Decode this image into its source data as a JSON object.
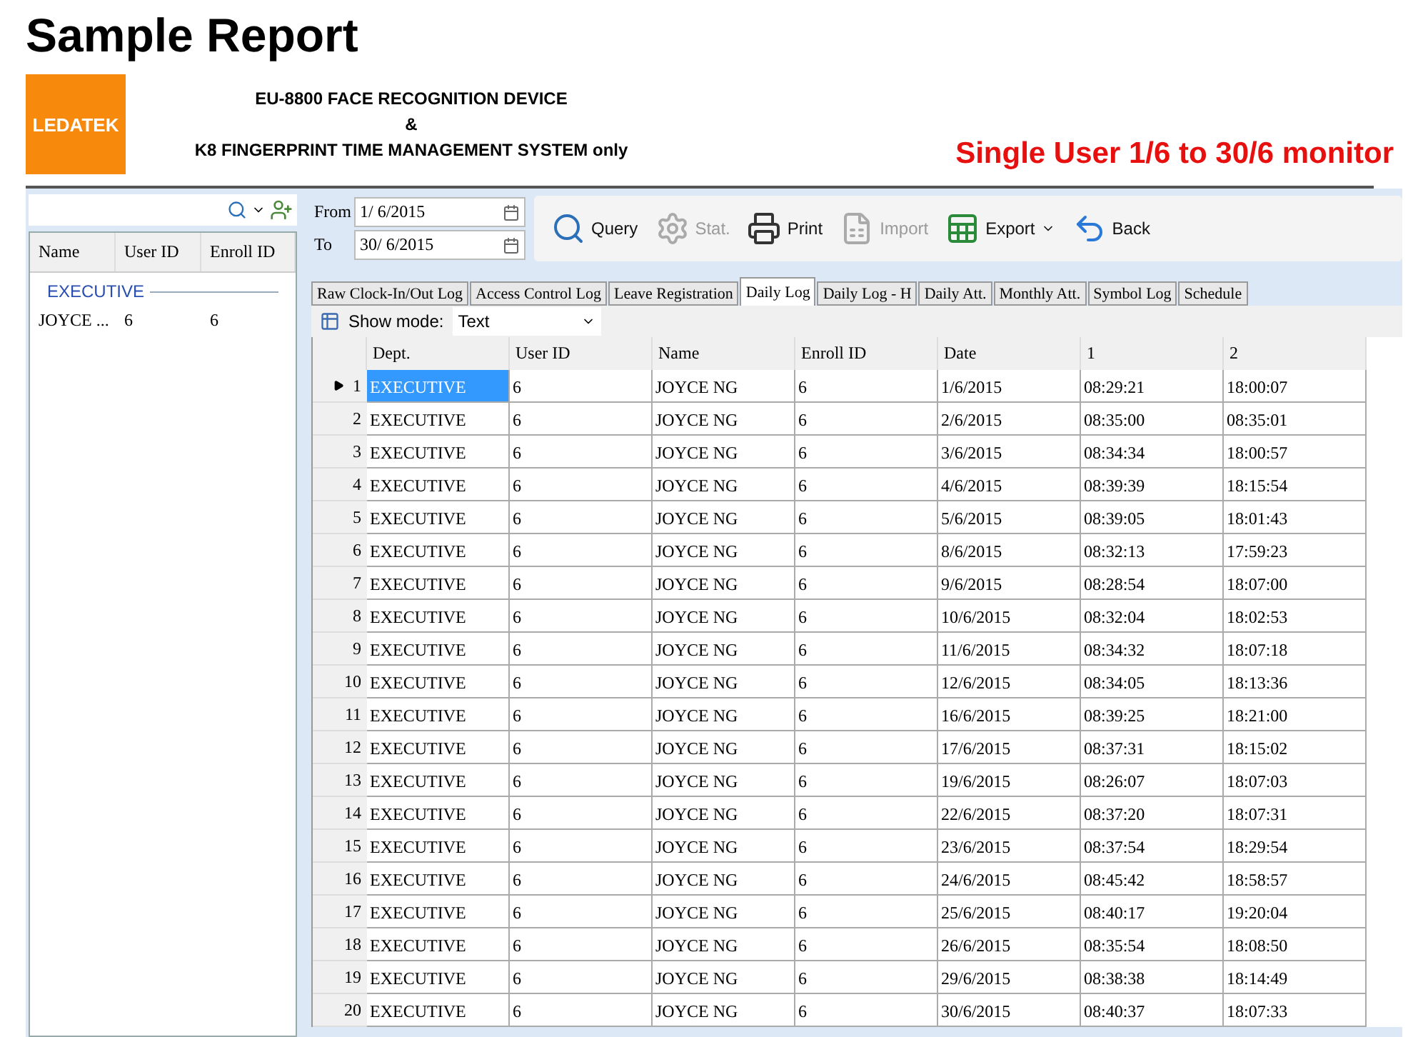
{
  "page_title": "Sample Report",
  "header": {
    "logo": "LEDATEK",
    "lines": [
      "EU-8800 FACE RECOGNITION DEVICE",
      "&",
      "K8 FINGERPRINT TIME MANAGEMENT SYSTEM only"
    ],
    "note": "Single User 1/6 to 30/6 monitor"
  },
  "employee_panel": {
    "columns": [
      "Name",
      "User ID",
      "Enroll ID"
    ],
    "group": "EXECUTIVE",
    "rows": [
      {
        "name": "JOYCE ...",
        "user_id": "6",
        "enroll_id": "6"
      }
    ]
  },
  "date_range": {
    "from_label": "From",
    "from": "1/ 6/2015",
    "to_label": "To",
    "to": "30/ 6/2015"
  },
  "toolbar": [
    {
      "kind": "query",
      "label": "Query",
      "disabled": false
    },
    {
      "kind": "stat",
      "label": "Stat.",
      "disabled": true
    },
    {
      "kind": "print",
      "label": "Print",
      "disabled": false
    },
    {
      "kind": "import",
      "label": "Import",
      "disabled": true
    },
    {
      "kind": "export",
      "label": "Export",
      "disabled": false
    },
    {
      "kind": "back",
      "label": "Back",
      "disabled": false
    }
  ],
  "tabs": [
    {
      "label": "Raw Clock-In/Out Log",
      "selected": false
    },
    {
      "label": "Access Control Log",
      "selected": false
    },
    {
      "label": "Leave Registration",
      "selected": false
    },
    {
      "label": "Daily Log",
      "selected": true
    },
    {
      "label": "Daily Log - H",
      "selected": false
    },
    {
      "label": "Daily Att.",
      "selected": false
    },
    {
      "label": "Monthly Att.",
      "selected": false
    },
    {
      "label": "Symbol Log",
      "selected": false
    },
    {
      "label": "Schedule",
      "selected": false
    }
  ],
  "show_mode": {
    "label": "Show mode:",
    "value": "Text"
  },
  "table": {
    "columns": [
      "Dept.",
      "User ID",
      "Name",
      "Enroll ID",
      "Date",
      "1",
      "2"
    ],
    "rows": [
      {
        "n": "1",
        "selected": true,
        "cells": [
          "EXECUTIVE",
          "6",
          "JOYCE NG",
          "6",
          "1/6/2015",
          "08:29:21",
          "18:00:07"
        ]
      },
      {
        "n": "2",
        "selected": false,
        "cells": [
          "EXECUTIVE",
          "6",
          "JOYCE NG",
          "6",
          "2/6/2015",
          "08:35:00",
          "08:35:01"
        ]
      },
      {
        "n": "3",
        "selected": false,
        "cells": [
          "EXECUTIVE",
          "6",
          "JOYCE NG",
          "6",
          "3/6/2015",
          "08:34:34",
          "18:00:57"
        ]
      },
      {
        "n": "4",
        "selected": false,
        "cells": [
          "EXECUTIVE",
          "6",
          "JOYCE NG",
          "6",
          "4/6/2015",
          "08:39:39",
          "18:15:54"
        ]
      },
      {
        "n": "5",
        "selected": false,
        "cells": [
          "EXECUTIVE",
          "6",
          "JOYCE NG",
          "6",
          "5/6/2015",
          "08:39:05",
          "18:01:43"
        ]
      },
      {
        "n": "6",
        "selected": false,
        "cells": [
          "EXECUTIVE",
          "6",
          "JOYCE NG",
          "6",
          "8/6/2015",
          "08:32:13",
          "17:59:23"
        ]
      },
      {
        "n": "7",
        "selected": false,
        "cells": [
          "EXECUTIVE",
          "6",
          "JOYCE NG",
          "6",
          "9/6/2015",
          "08:28:54",
          "18:07:00"
        ]
      },
      {
        "n": "8",
        "selected": false,
        "cells": [
          "EXECUTIVE",
          "6",
          "JOYCE NG",
          "6",
          "10/6/2015",
          "08:32:04",
          "18:02:53"
        ]
      },
      {
        "n": "9",
        "selected": false,
        "cells": [
          "EXECUTIVE",
          "6",
          "JOYCE NG",
          "6",
          "11/6/2015",
          "08:34:32",
          "18:07:18"
        ]
      },
      {
        "n": "10",
        "selected": false,
        "cells": [
          "EXECUTIVE",
          "6",
          "JOYCE NG",
          "6",
          "12/6/2015",
          "08:34:05",
          "18:13:36"
        ]
      },
      {
        "n": "11",
        "selected": false,
        "cells": [
          "EXECUTIVE",
          "6",
          "JOYCE NG",
          "6",
          "16/6/2015",
          "08:39:25",
          "18:21:00"
        ]
      },
      {
        "n": "12",
        "selected": false,
        "cells": [
          "EXECUTIVE",
          "6",
          "JOYCE NG",
          "6",
          "17/6/2015",
          "08:37:31",
          "18:15:02"
        ]
      },
      {
        "n": "13",
        "selected": false,
        "cells": [
          "EXECUTIVE",
          "6",
          "JOYCE NG",
          "6",
          "19/6/2015",
          "08:26:07",
          "18:07:03"
        ]
      },
      {
        "n": "14",
        "selected": false,
        "cells": [
          "EXECUTIVE",
          "6",
          "JOYCE NG",
          "6",
          "22/6/2015",
          "08:37:20",
          "18:07:31"
        ]
      },
      {
        "n": "15",
        "selected": false,
        "cells": [
          "EXECUTIVE",
          "6",
          "JOYCE NG",
          "6",
          "23/6/2015",
          "08:37:54",
          "18:29:54"
        ]
      },
      {
        "n": "16",
        "selected": false,
        "cells": [
          "EXECUTIVE",
          "6",
          "JOYCE NG",
          "6",
          "24/6/2015",
          "08:45:42",
          "18:58:57"
        ]
      },
      {
        "n": "17",
        "selected": false,
        "cells": [
          "EXECUTIVE",
          "6",
          "JOYCE NG",
          "6",
          "25/6/2015",
          "08:40:17",
          "19:20:04"
        ]
      },
      {
        "n": "18",
        "selected": false,
        "cells": [
          "EXECUTIVE",
          "6",
          "JOYCE NG",
          "6",
          "26/6/2015",
          "08:35:54",
          "18:08:50"
        ]
      },
      {
        "n": "19",
        "selected": false,
        "cells": [
          "EXECUTIVE",
          "6",
          "JOYCE NG",
          "6",
          "29/6/2015",
          "08:38:38",
          "18:14:49"
        ]
      },
      {
        "n": "20",
        "selected": false,
        "cells": [
          "EXECUTIVE",
          "6",
          "JOYCE NG",
          "6",
          "30/6/2015",
          "08:40:37",
          "18:07:33"
        ]
      }
    ]
  }
}
